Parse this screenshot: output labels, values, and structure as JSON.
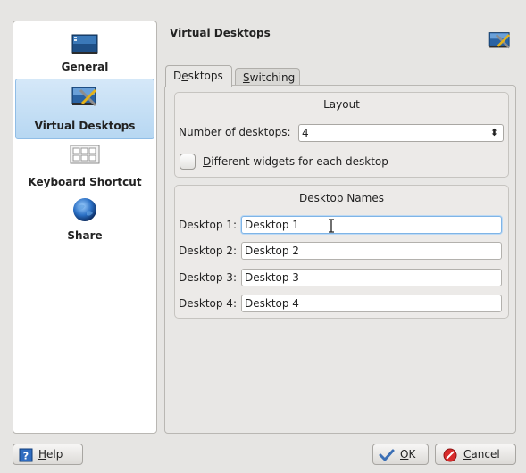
{
  "sidebar": {
    "items": [
      {
        "label": "General",
        "icon": "desktop-icon"
      },
      {
        "label": "Virtual Desktops",
        "icon": "virtual-desktops-icon"
      },
      {
        "label": "Keyboard Shortcut",
        "icon": "keyboard-icon"
      },
      {
        "label": "Share",
        "icon": "globe-icon"
      }
    ]
  },
  "page": {
    "title": "Virtual Desktops"
  },
  "tabs": {
    "desktops_pre": "D",
    "desktops_u": "e",
    "desktops_post": "sktops",
    "switching_u": "S",
    "switching_post": "witching"
  },
  "layout_group": {
    "title": "Layout",
    "num_label_u": "N",
    "num_label_rest": "umber of desktops:",
    "num_value": "4",
    "diff_u": "D",
    "diff_rest": "ifferent widgets for each desktop"
  },
  "names_group": {
    "title": "Desktop Names",
    "rows": [
      {
        "label": "Desktop 1:",
        "value": "Desktop 1"
      },
      {
        "label": "Desktop 2:",
        "value": "Desktop 2"
      },
      {
        "label": "Desktop 3:",
        "value": "Desktop 3"
      },
      {
        "label": "Desktop 4:",
        "value": "Desktop 4"
      }
    ]
  },
  "buttons": {
    "help_u": "H",
    "help_rest": "elp",
    "ok_u": "O",
    "ok_rest": "K",
    "cancel_u": "C",
    "cancel_rest": "ancel"
  },
  "colors": {
    "accent": "#b7d7f2",
    "focus_border": "#7fb4e6",
    "background": "#e6e5e3"
  }
}
